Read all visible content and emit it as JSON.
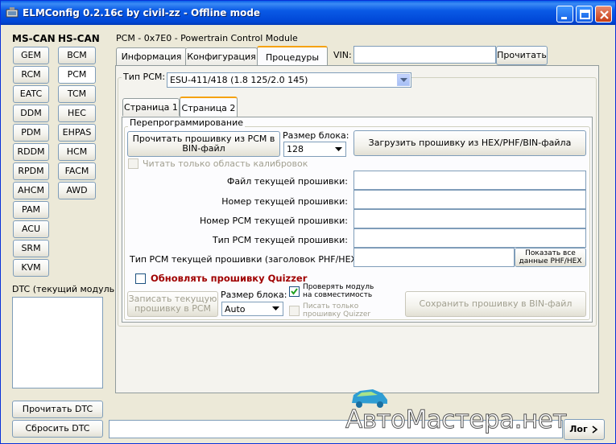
{
  "window": {
    "title": "ELMConfig 0.2.16c by civil-zz - Offline mode"
  },
  "sidebar": {
    "ms_can_header": "MS-CAN",
    "hs_can_header": "HS-CAN",
    "ms_can_modules": [
      "GEM",
      "RCM",
      "EATC",
      "DDM",
      "PDM",
      "RDDM",
      "RPDM",
      "AHCM",
      "PAM",
      "ACU",
      "SRM",
      "KVM"
    ],
    "hs_can_modules": [
      "BCM",
      "PCM",
      "TCM",
      "HEC",
      "EHPAS",
      "HCM",
      "FACM",
      "AWD"
    ],
    "selected_module": "PCM",
    "dtc_label": "DTC (текущий модуль):",
    "read_dtc": "Прочитать DTC",
    "clear_dtc": "Сбросить DTC"
  },
  "main": {
    "module_title": "PCM - 0x7E0 - Powertrain Control Module",
    "tabs": [
      "Информация",
      "Конфигурация",
      "Процедуры"
    ],
    "selected_tab": "Процедуры",
    "vin_label": "VIN:",
    "vin_value": "",
    "vin_read_button": "Прочитать",
    "pcm_type_label": "Тип PCM:",
    "pcm_type_value": "ESU-411/418 (1.8 125/2.0 145)",
    "subtabs": [
      "Страница 1",
      "Страница 2"
    ],
    "selected_subtab": "Страница 2",
    "reprog": {
      "group_title": "Перепрограммирование",
      "read_firmware_button": "Прочитать прошивку из PCM в BIN-файл",
      "block_size_label": "Размер блока:",
      "block_size_value": "128",
      "load_firmware_button": "Загрузить прошивку из HEX/PHF/BIN-файла",
      "read_calib_only": "Читать только область калибровок",
      "fields": [
        {
          "label": "Файл текущей прошивки:",
          "value": ""
        },
        {
          "label": "Номер текущей прошивки:",
          "value": ""
        },
        {
          "label": "Номер PCM текущей прошивки:",
          "value": ""
        },
        {
          "label": "Тип PCM текущей прошивки:",
          "value": ""
        },
        {
          "label": "Тип PCM текущей прошивки (заголовок PHF/HEX):",
          "value": ""
        }
      ],
      "show_all_button": "Показать все данные PHF/HEX",
      "update_quizzer": "Обновлять прошивку Quizzer",
      "write_firmware_button": "Записать текущую прошивку в PCM",
      "block_size2_label": "Размер блока:",
      "block_size2_value": "Auto",
      "check_compat": "Проверять модуль на совместимость",
      "write_quizzer_only": "Писать только прошивку Quizzer",
      "save_bin_button": "Сохранить прошивку в BIN-файл"
    }
  },
  "footer": {
    "status_value": "",
    "log_button": "Лог",
    "watermark": "АвтоМастера.нет"
  },
  "colors": {
    "title_bar": "#0a5ae6",
    "window_bg": "#ece9d8",
    "quizzer_red": "#a00000",
    "tab_highlight": "#f5a20f"
  }
}
